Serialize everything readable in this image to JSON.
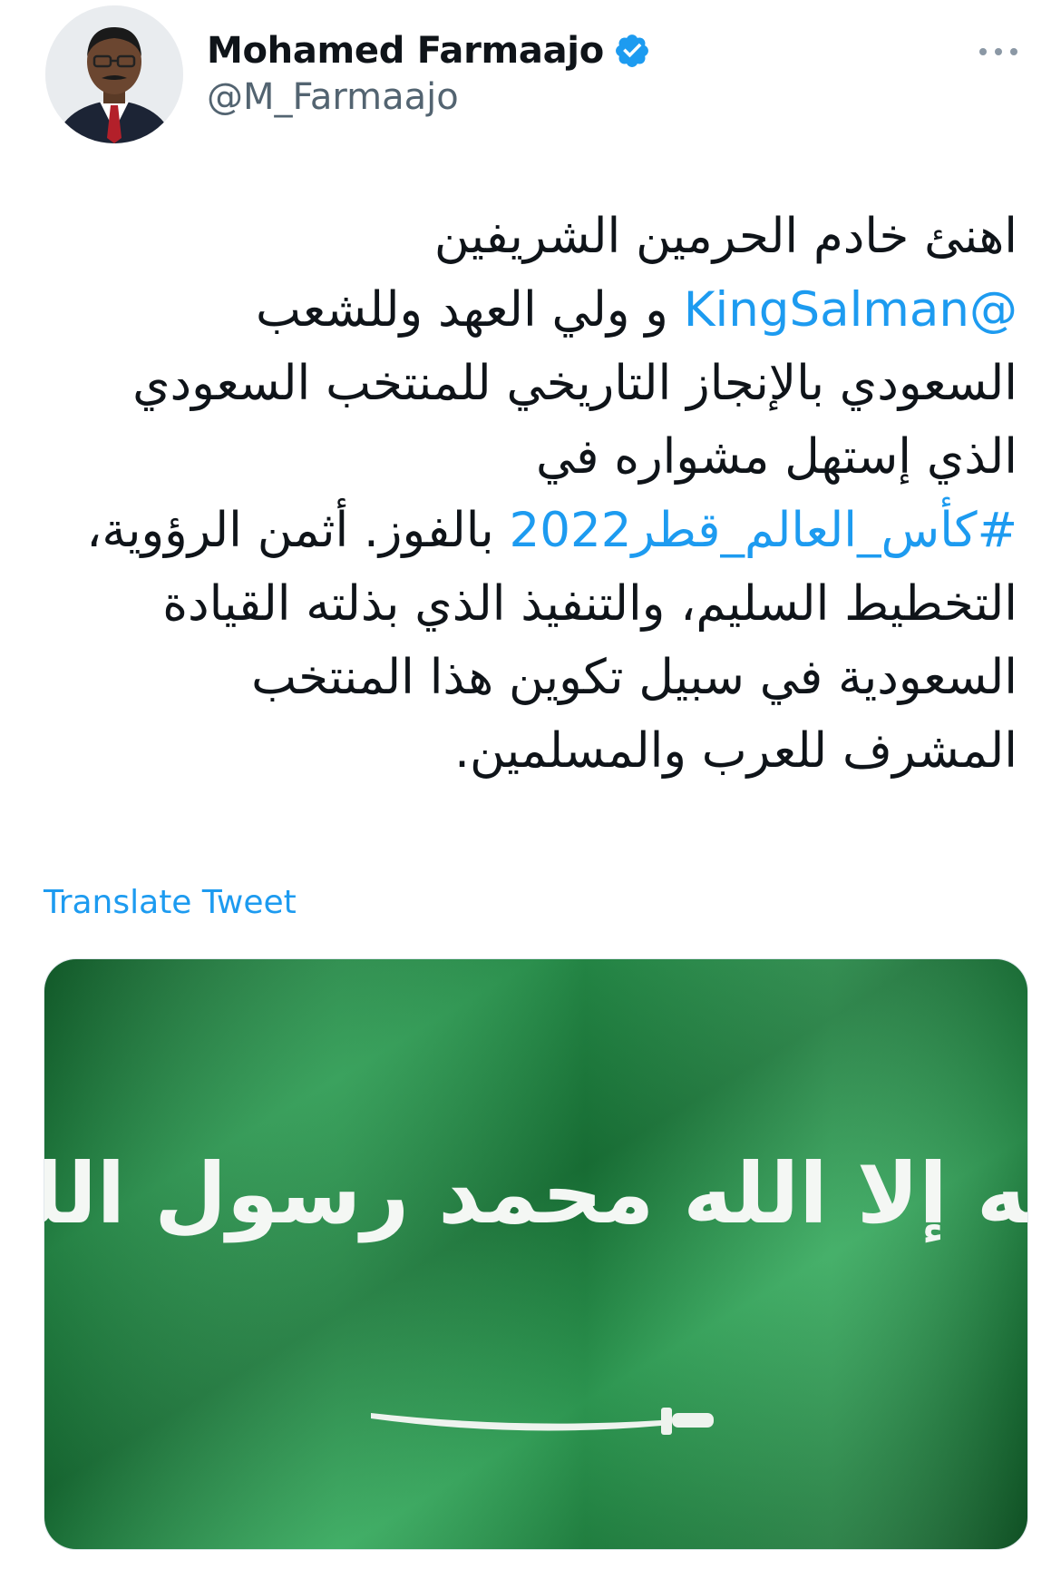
{
  "author": {
    "display_name": "Mohamed Farmaajo",
    "handle": "@M_Farmaajo",
    "verified": true,
    "avatar_icon": "profile-photo"
  },
  "tweet": {
    "lines": [
      [
        {
          "text": "اهنئ خادم الحرمين الشريفين",
          "type": "text"
        }
      ],
      [
        {
          "text": "@KingSalman",
          "type": "mention"
        },
        {
          "text": " و ولي العهد وللشعب",
          "type": "text"
        }
      ],
      [
        {
          "text": "السعودي بالإنجاز التاريخي للمنتخب السعودي",
          "type": "text"
        }
      ],
      [
        {
          "text": "الذي إستهل مشواره في",
          "type": "text"
        }
      ],
      [
        {
          "text": "#كأس_العالم_قطر2022",
          "type": "hashtag"
        },
        {
          "text": " بالفوز. أثمن الرؤوية،",
          "type": "text"
        }
      ],
      [
        {
          "text": "التخطيط السليم، والتنفيذ الذي بذلته القيادة",
          "type": "text"
        }
      ],
      [
        {
          "text": "السعودية في سبيل تكوين هذا المنتخب",
          "type": "text"
        }
      ],
      [
        {
          "text": "المشرف للعرب والمسلمين.",
          "type": "text"
        }
      ]
    ],
    "translate_label": "Translate Tweet"
  },
  "media": {
    "description_icon": "saudi-flag-image",
    "flag_text": "لا إله إلا الله محمد رسول الله"
  },
  "colors": {
    "link": "#1d9bf0",
    "verified": "#1d9bf0",
    "text": "#0f1419",
    "secondary": "#536471",
    "flag_green": "#1f8a43"
  },
  "icons": {
    "more": "more-horizontal-icon",
    "verified": "verified-badge-icon"
  }
}
